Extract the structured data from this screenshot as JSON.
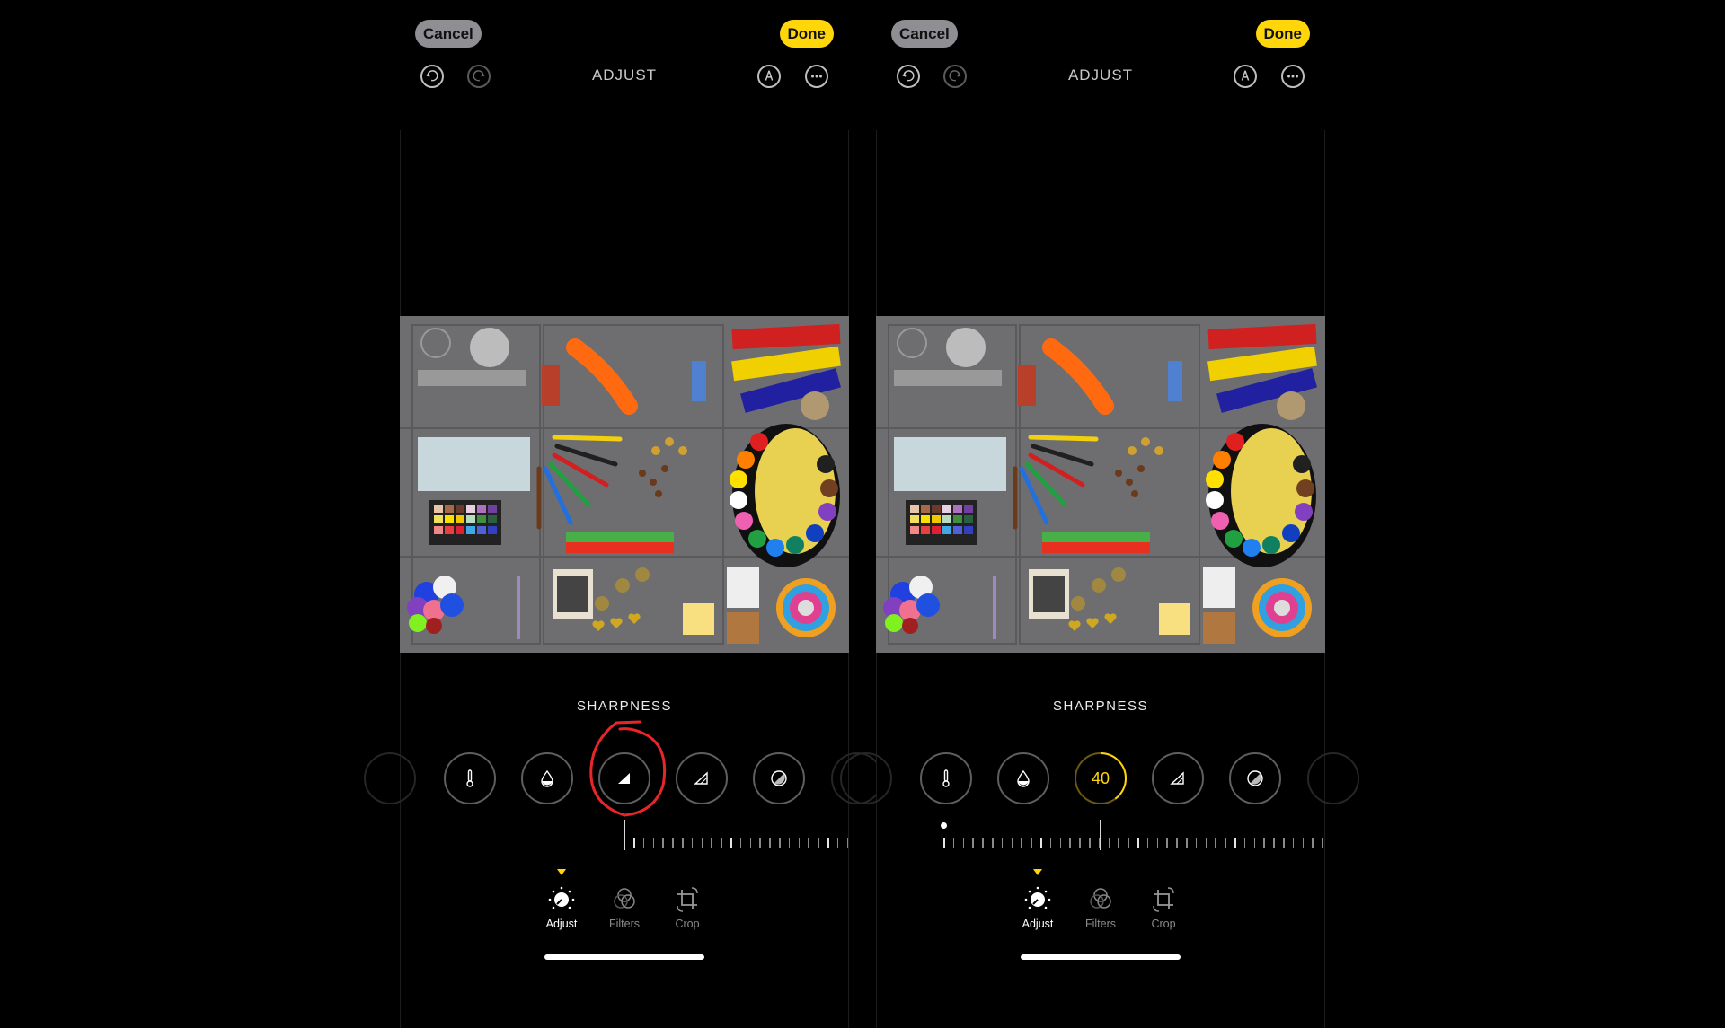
{
  "panels": [
    {
      "id": "before",
      "header": {
        "cancel_label": "Cancel",
        "done_label": "Done",
        "title": "ADJUST"
      },
      "icons": {
        "undo": "undo-icon",
        "redo": "redo-icon",
        "markup": "markup-pen-icon",
        "more": "more-ellipsis-icon"
      },
      "adjustment_label": "SHARPNESS",
      "tools": [
        {
          "name": "warmth",
          "icon": "thermometer-icon"
        },
        {
          "name": "tint",
          "icon": "droplet-icon"
        },
        {
          "name": "sharpness",
          "icon": "sharpness-triangle-icon",
          "selected": true,
          "value": null
        },
        {
          "name": "definition",
          "icon": "definition-triangle-icon"
        },
        {
          "name": "noise-reduction",
          "icon": "noise-reduction-icon"
        }
      ],
      "slider": {
        "value": 0,
        "min": 0,
        "max": 100
      },
      "annotation": {
        "type": "red-circle",
        "target": "sharpness",
        "color": "#e8262a"
      },
      "tabs": [
        {
          "label": "Adjust",
          "icon": "adjust-dial-icon",
          "active": true
        },
        {
          "label": "Filters",
          "icon": "filters-icon",
          "active": false
        },
        {
          "label": "Crop",
          "icon": "crop-rotate-icon",
          "active": false
        }
      ]
    },
    {
      "id": "after",
      "header": {
        "cancel_label": "Cancel",
        "done_label": "Done",
        "title": "ADJUST"
      },
      "icons": {
        "undo": "undo-icon",
        "redo": "redo-icon",
        "markup": "markup-pen-icon",
        "more": "more-ellipsis-icon"
      },
      "adjustment_label": "SHARPNESS",
      "tools": [
        {
          "name": "warmth",
          "icon": "thermometer-icon"
        },
        {
          "name": "tint",
          "icon": "droplet-icon"
        },
        {
          "name": "sharpness",
          "icon": "sharpness-triangle-icon",
          "selected": true,
          "value": "40"
        },
        {
          "name": "definition",
          "icon": "definition-triangle-icon"
        },
        {
          "name": "noise-reduction",
          "icon": "noise-reduction-icon"
        }
      ],
      "slider": {
        "value": 40,
        "min": 0,
        "max": 100
      },
      "tabs": [
        {
          "label": "Adjust",
          "icon": "adjust-dial-icon",
          "active": true
        },
        {
          "label": "Filters",
          "icon": "filters-icon",
          "active": false
        },
        {
          "label": "Crop",
          "icon": "crop-rotate-icon",
          "active": false
        }
      ]
    }
  ],
  "colors": {
    "accent": "#ffd60a",
    "cancel_bg": "#8e8e93",
    "annotation": "#e8262a"
  },
  "photo": {
    "description": "Test chart with colored objects: paint tubes, palette, pencils, color checker, banknote, pom-poms, color wheel"
  }
}
